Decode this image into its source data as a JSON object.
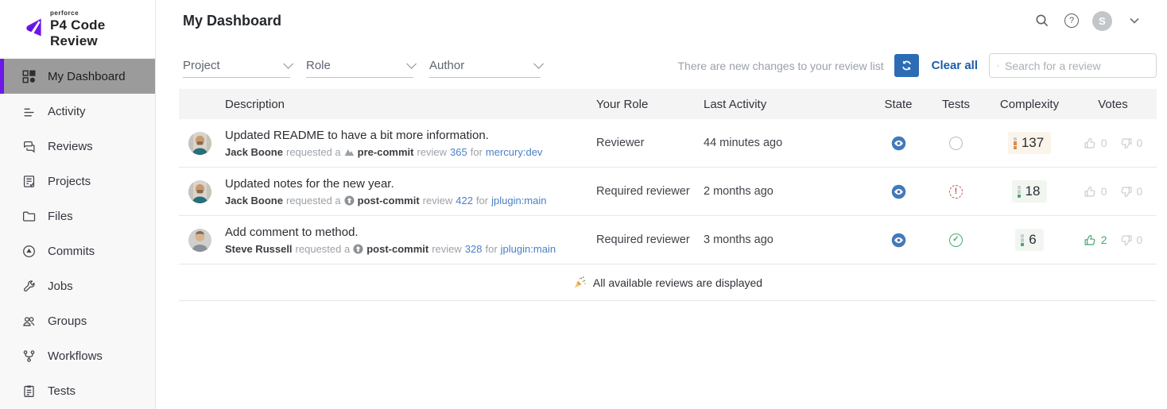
{
  "brand": {
    "superscript": "perforce",
    "name": "P4 Code Review",
    "accent_purple": "#6d17e8"
  },
  "topbar": {
    "page_title": "My Dashboard",
    "avatar_initial": "S"
  },
  "sidebar": {
    "items": [
      {
        "label": "My Dashboard",
        "icon": "dashboard-icon",
        "active": true
      },
      {
        "label": "Activity",
        "icon": "activity-icon",
        "active": false
      },
      {
        "label": "Reviews",
        "icon": "reviews-icon",
        "active": false
      },
      {
        "label": "Projects",
        "icon": "projects-icon",
        "active": false
      },
      {
        "label": "Files",
        "icon": "files-icon",
        "active": false
      },
      {
        "label": "Commits",
        "icon": "commits-icon",
        "active": false
      },
      {
        "label": "Jobs",
        "icon": "jobs-icon",
        "active": false
      },
      {
        "label": "Groups",
        "icon": "groups-icon",
        "active": false
      },
      {
        "label": "Workflows",
        "icon": "workflows-icon",
        "active": false
      },
      {
        "label": "Tests",
        "icon": "tests-icon",
        "active": false
      }
    ]
  },
  "filters": {
    "project": "Project",
    "role": "Role",
    "author": "Author"
  },
  "notice": {
    "message": "There are new changes to your review list",
    "clear_all": "Clear all",
    "refresh_color": "#2d6cb4"
  },
  "search": {
    "placeholder": "Search for a review"
  },
  "table": {
    "headers": {
      "description": "Description",
      "your_role": "Your Role",
      "last_activity": "Last Activity",
      "state": "State",
      "tests": "Tests",
      "complexity": "Complexity",
      "votes": "Votes"
    },
    "rows": [
      {
        "title": "Updated README to have a bit more information.",
        "author": "Jack Boone",
        "requested_text": "requested a",
        "commit_type": "pre-commit",
        "review_text": "review",
        "review_id": "365",
        "for_text": "for",
        "target": "mercury:dev",
        "role": "Reviewer",
        "last_activity": "44 minutes ago",
        "state": "needs-review",
        "tests_status": "not-run",
        "complexity": "137",
        "complexity_level": "high",
        "up_count": "0",
        "up_on": "false",
        "down_count": "0",
        "down_on": "false"
      },
      {
        "title": "Updated notes for the new year.",
        "author": "Jack Boone",
        "requested_text": "requested a",
        "commit_type": "post-commit",
        "review_text": "review",
        "review_id": "422",
        "for_text": "for",
        "target": "jplugin:main",
        "role": "Required reviewer",
        "last_activity": "2 months ago",
        "state": "needs-review",
        "tests_status": "fail",
        "complexity": "18",
        "complexity_level": "low",
        "up_count": "0",
        "up_on": "false",
        "down_count": "0",
        "down_on": "false"
      },
      {
        "title": "Add comment to method.",
        "author": "Steve Russell",
        "requested_text": "requested a",
        "commit_type": "post-commit",
        "review_text": "review",
        "review_id": "328",
        "for_text": "for",
        "target": "jplugin:main",
        "role": "Required reviewer",
        "last_activity": "3 months ago",
        "state": "needs-review",
        "tests_status": "pass",
        "complexity": "6",
        "complexity_level": "low",
        "up_count": "2",
        "up_on": "true",
        "down_count": "0",
        "down_on": "false"
      }
    ]
  },
  "footer": {
    "emoji": "🎉",
    "message": "All available reviews are displayed"
  }
}
